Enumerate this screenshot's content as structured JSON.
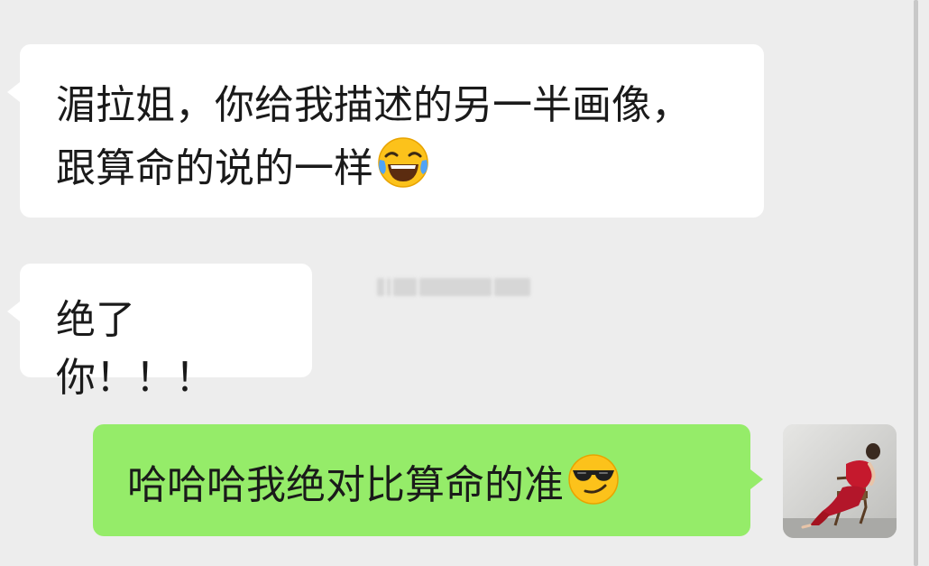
{
  "chat": {
    "messages": [
      {
        "id": "m1",
        "direction": "received",
        "text": "湄拉姐，你给我描述的另一半画像，跟算命的说的一样",
        "emoji": "tears-of-joy-emoji"
      },
      {
        "id": "m2",
        "direction": "received",
        "text": "绝了你！！！",
        "emoji": ""
      },
      {
        "id": "m3",
        "direction": "sent",
        "text": "哈哈哈我绝对比算命的准",
        "emoji": "sunglasses-smirk-emoji"
      }
    ],
    "self_avatar": {
      "icon": "user-avatar-photo"
    }
  },
  "colors": {
    "background": "#ededed",
    "received_bubble": "#ffffff",
    "sent_bubble": "#95ec69",
    "text": "#1a1a1a"
  }
}
